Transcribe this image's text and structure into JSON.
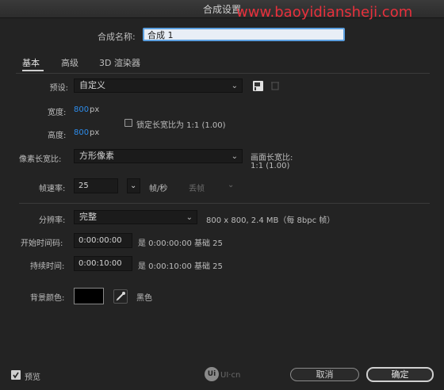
{
  "window": {
    "title": "合成设置",
    "watermark": "www.baoyidiansheji.com"
  },
  "comp_name": {
    "label": "合成名称:",
    "value": "合成 1"
  },
  "tabs": [
    {
      "label": "基本"
    },
    {
      "label": "高级"
    },
    {
      "label": "3D 渲染器"
    }
  ],
  "preset": {
    "label": "预设:",
    "value": "自定义"
  },
  "width": {
    "label": "宽度:",
    "value": "800",
    "unit": "px"
  },
  "height": {
    "label": "高度:",
    "value": "800",
    "unit": "px"
  },
  "lock_aspect": {
    "label": "锁定长宽比为 1:1 (1.00)",
    "checked": false
  },
  "pixel_aspect": {
    "label": "像素长宽比:",
    "value": "方形像素"
  },
  "frame_aspect": {
    "label": "画面长宽比:",
    "value": "1:1 (1.00)"
  },
  "frame_rate": {
    "label": "帧速率:",
    "value": "25",
    "unit": "帧/秒",
    "drop_frame": "丢帧"
  },
  "resolution": {
    "label": "分辨率:",
    "value": "完整",
    "info": "800 x 800, 2.4 MB（每 8bpc 帧）"
  },
  "start_timecode": {
    "label": "开始时间码:",
    "value": "0:00:00:00",
    "info": "是 0:00:00:00  基础 25"
  },
  "duration": {
    "label": "持续时间:",
    "value": "0:00:10:00",
    "info": "是 0:00:10:00  基础 25"
  },
  "background": {
    "label": "背景颜色:",
    "color_name": "黑色",
    "color": "#000000"
  },
  "preview": {
    "label": "预览",
    "checked": true
  },
  "footer_logo": "UI·cn",
  "buttons": {
    "cancel": "取消",
    "ok": "确定"
  }
}
